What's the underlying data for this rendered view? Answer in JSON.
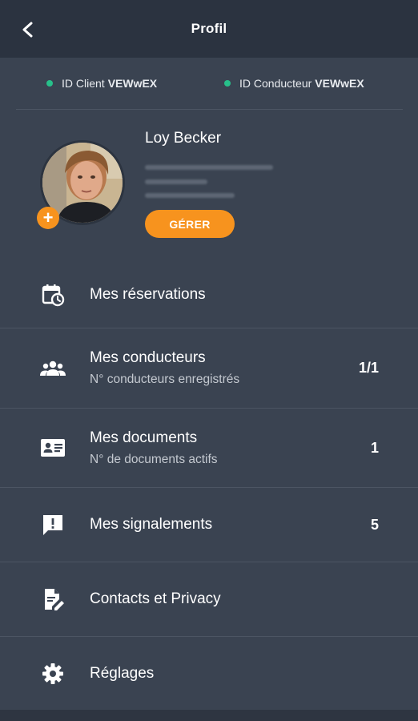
{
  "header": {
    "title": "Profil"
  },
  "ids": {
    "client_label": "ID Client",
    "client_value": "VEWwEX",
    "driver_label": "ID Conducteur",
    "driver_value": "VEWwEX"
  },
  "profile": {
    "name": "Loy Becker",
    "manage_label": "GÉRER"
  },
  "menu": [
    {
      "title": "Mes réservations",
      "subtitle": "",
      "count": ""
    },
    {
      "title": "Mes conducteurs",
      "subtitle": "N° conducteurs enregistrés",
      "count": "1/1"
    },
    {
      "title": "Mes documents",
      "subtitle": "N° de documents actifs",
      "count": "1"
    },
    {
      "title": "Mes signalements",
      "subtitle": "",
      "count": "5"
    },
    {
      "title": "Contacts et Privacy",
      "subtitle": "",
      "count": ""
    },
    {
      "title": "Réglages",
      "subtitle": "",
      "count": ""
    }
  ],
  "colors": {
    "background": "#3a4351",
    "topbar": "#2b3340",
    "accent": "#f7931e",
    "status_dot": "#27c08a"
  },
  "icons": {
    "back": "chevron-left-icon",
    "reservations": "calendar-clock-icon",
    "drivers": "group-icon",
    "documents": "id-card-icon",
    "reports": "alert-message-icon",
    "contacts": "document-edit-icon",
    "settings": "gear-icon"
  }
}
